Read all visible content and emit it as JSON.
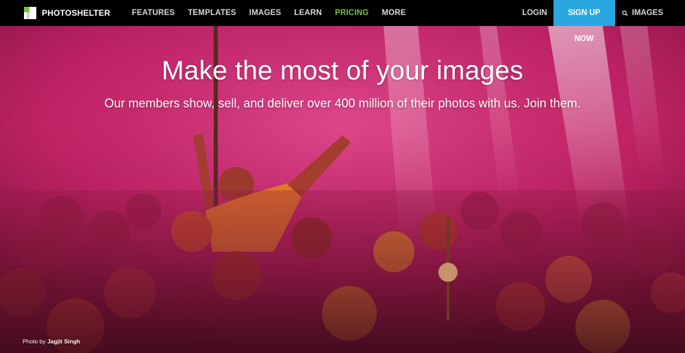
{
  "brand": {
    "name": "PHOTOSHELTER"
  },
  "nav": {
    "items": [
      {
        "label": "FEATURES",
        "color": "#d8d8d8"
      },
      {
        "label": "TEMPLATES",
        "color": "#d8d8d8"
      },
      {
        "label": "IMAGES",
        "color": "#d8d8d8"
      },
      {
        "label": "LEARN",
        "color": "#d8d8d8"
      },
      {
        "label": "PRICING",
        "color": "#7cc140"
      },
      {
        "label": "MORE",
        "color": "#d8d8d8"
      }
    ],
    "login_label": "LOGIN",
    "signup_label": "SIGN UP NOW",
    "images_search_label": "IMAGES",
    "accent_color": "#29a7e0"
  },
  "hero": {
    "title": "Make the most of your images",
    "subtitle": "Our members show, sell, and deliver over 400 million of their photos with us. Join them.",
    "credit_prefix": "Photo by",
    "credit_name": "Jagjit Singh"
  },
  "icons": {
    "logo": "photoshelter-logo-icon",
    "search": "search-icon"
  }
}
